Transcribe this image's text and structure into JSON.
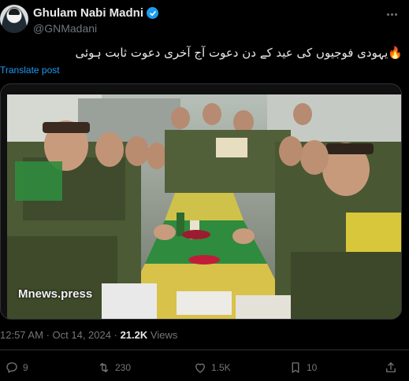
{
  "author": {
    "name": "Ghulam Nabi Madni",
    "handle": "@GNMadani",
    "verified": true
  },
  "tweet": {
    "text": "یہودی فوجیوں کی عید کے دن دعوت آج آخری دعوت ثابت ہوئی",
    "emoji": "🔥",
    "translate_label": "Translate post"
  },
  "media": {
    "watermark": "Mnews.press"
  },
  "meta": {
    "time": "12:57 AM",
    "separator": "·",
    "date": "Oct 14, 2024",
    "views_count": "21.2K",
    "views_label": "Views"
  },
  "actions": {
    "replies": "9",
    "reposts": "230",
    "likes": "1.5K",
    "bookmarks": "10"
  },
  "colors": {
    "background": "#000000",
    "accent": "#1d9bf0",
    "muted": "#71767b",
    "text": "#e7e9ea"
  },
  "icons": [
    "verified-badge-icon",
    "more-icon",
    "reply-icon",
    "repost-icon",
    "like-icon",
    "bookmark-icon",
    "share-icon"
  ]
}
